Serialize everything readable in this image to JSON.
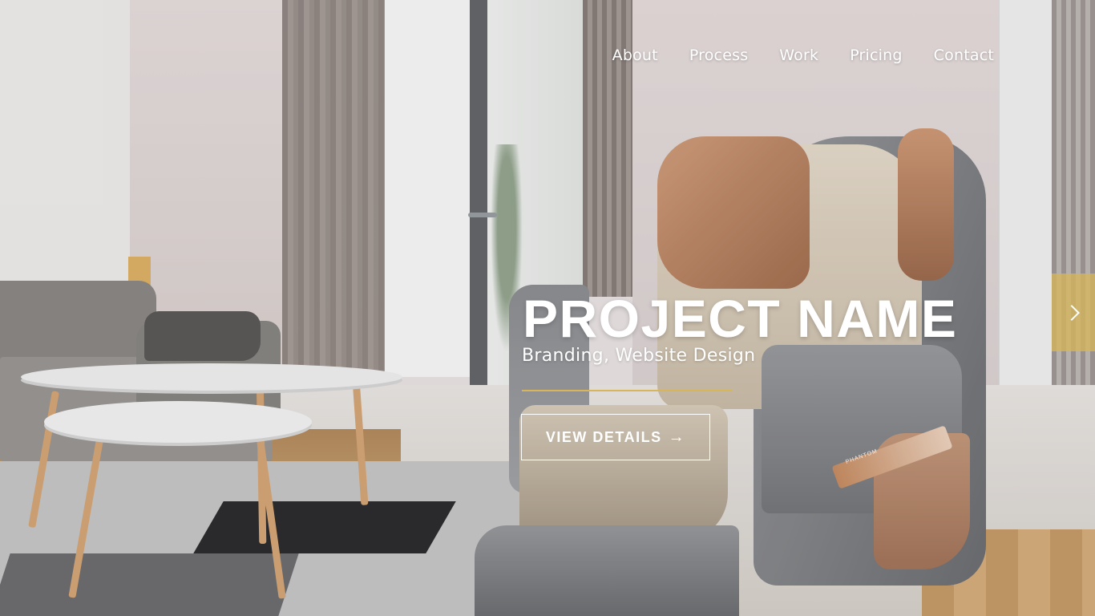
{
  "nav": {
    "items": [
      {
        "label": "About"
      },
      {
        "label": "Process"
      },
      {
        "label": "Work"
      },
      {
        "label": "Pricing"
      },
      {
        "label": "Contact"
      }
    ]
  },
  "hero": {
    "title": "PROJECT NAME",
    "subtitle": "Branding, Website Design",
    "cta_label": "VIEW DETAILS",
    "cta_arrow": "→",
    "product_badge": "PHANTOM"
  },
  "slider": {
    "next_icon": "chevron-right-icon"
  },
  "colors": {
    "accent": "#d9b55a",
    "text": "#ffffff"
  }
}
